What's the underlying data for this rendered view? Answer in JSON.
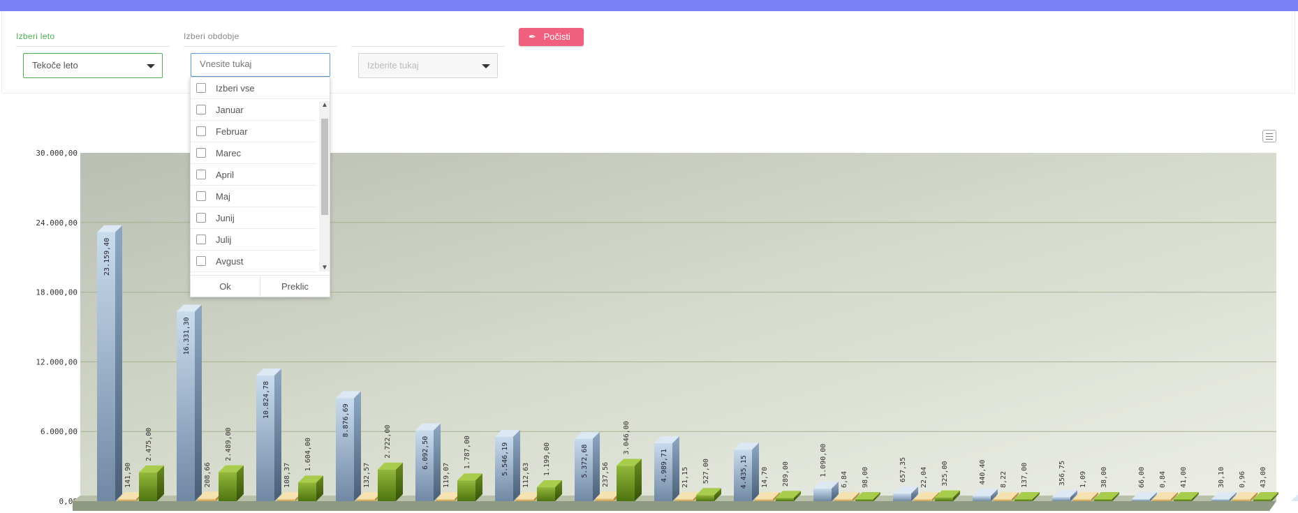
{
  "filters": {
    "year_label": "Izberi leto",
    "year_value": "Tekoče leto",
    "period_label": "Izberi obdobje",
    "period_placeholder": "Vnesite tukaj",
    "third_placeholder": "Izberite tukaj",
    "clear_button": "Počisti"
  },
  "dropdown": {
    "select_all": "Izberi vse",
    "items": [
      "Januar",
      "Februar",
      "Marec",
      "April",
      "Maj",
      "Junij",
      "Julij",
      "Avgust"
    ],
    "ok": "Ok",
    "cancel": "Preklic"
  },
  "colors": {
    "accent_bar": "#7a80f6",
    "year_green": "#4caf50",
    "clear_button": "#f0607e",
    "series_blue": "#a9c1da",
    "series_yellow": "#e8c27a",
    "series_green": "#5f8a17"
  },
  "chart_data": {
    "type": "bar",
    "style": "3d-column",
    "ylim": [
      0,
      30000
    ],
    "yticks": [
      "0,00",
      "6.000,00",
      "12.000,00",
      "18.000,00",
      "24.000,00",
      "30.000,00"
    ],
    "grid": true,
    "categories": [
      "",
      "",
      "",
      "",
      "",
      "",
      "",
      "",
      "",
      "",
      "",
      "",
      "",
      "",
      "",
      ""
    ],
    "series": [
      {
        "values": [
          23159.4,
          16331.3,
          10824.78,
          8876.69,
          6092.5,
          5546.19,
          5372.68,
          4989.71,
          4435.15,
          1090.0,
          657.35,
          440.4,
          356.75,
          66.0,
          30.1,
          0
        ],
        "labels": [
          "23.159,40",
          "16.331,30",
          "10.824,78",
          "8.876,69",
          "6.092,50",
          "5.546,19",
          "5.372,68",
          "4.989,71",
          "4.435,15",
          "1.090,00",
          "657,35",
          "440,40",
          "356,75",
          "66,00",
          "30,10",
          ""
        ]
      },
      {
        "values": [
          141.9,
          208.66,
          108.37,
          132.57,
          119.07,
          112.63,
          237.56,
          21.15,
          14.7,
          6.84,
          22.04,
          8.22,
          1.09,
          0.84,
          0.96,
          0
        ],
        "labels": [
          "141,90",
          "208,66",
          "108,37",
          "132,57",
          "119,07",
          "112,63",
          "237,56",
          "21,15",
          "14,70",
          "6,84",
          "22,04",
          "8,22",
          "1,09",
          "0,84",
          "0,96",
          ""
        ]
      },
      {
        "values": [
          2475.0,
          2489.0,
          1604.0,
          2722.0,
          1787.0,
          1199.0,
          3046.0,
          527.0,
          289.0,
          98.0,
          325.0,
          137.0,
          38.0,
          41.0,
          43.0,
          0
        ],
        "labels": [
          "2.475,00",
          "2.489,00",
          "1.604,00",
          "2.722,00",
          "1.787,00",
          "1.199,00",
          "3.046,00",
          "527,00",
          "289,00",
          "98,00",
          "325,00",
          "137,00",
          "38,00",
          "41,00",
          "43,00",
          ""
        ]
      }
    ]
  }
}
